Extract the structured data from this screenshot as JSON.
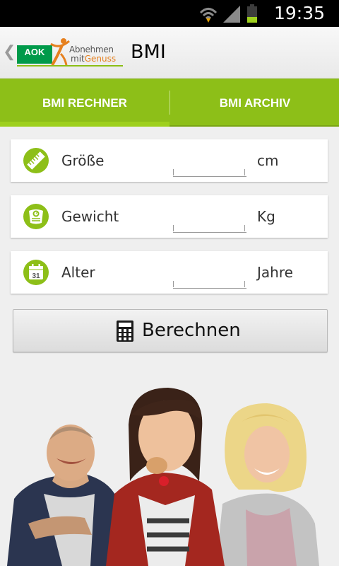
{
  "status_bar": {
    "time": "19:35",
    "icons": [
      "wifi-icon",
      "signal-icon",
      "battery-icon"
    ]
  },
  "action_bar": {
    "back_icon": "chevron-left-icon",
    "logo": {
      "brand": "AOK",
      "line1": "Abnehmen",
      "line2_a": "mit",
      "line2_b": "Genuss"
    },
    "title": "BMI"
  },
  "tabs": [
    {
      "label": "BMI RECHNER",
      "selected": true
    },
    {
      "label": "BMI ARCHIV",
      "selected": false
    }
  ],
  "form": {
    "height": {
      "label": "Größe",
      "value": "",
      "unit": "cm",
      "icon": "ruler-icon"
    },
    "weight": {
      "label": "Gewicht",
      "value": "",
      "unit": "Kg",
      "icon": "scale-icon"
    },
    "age": {
      "label": "Alter",
      "value": "",
      "unit": "Jahre",
      "icon": "calendar-icon",
      "icon_text": "31"
    }
  },
  "calculate_button": {
    "label": "Berechnen",
    "icon": "calculator-icon"
  },
  "colors": {
    "accent": "#8dbf18",
    "action_bar": "#f3f3f3",
    "background": "#efefef",
    "brand_green": "#009a4a",
    "brand_orange": "#e6801e"
  }
}
